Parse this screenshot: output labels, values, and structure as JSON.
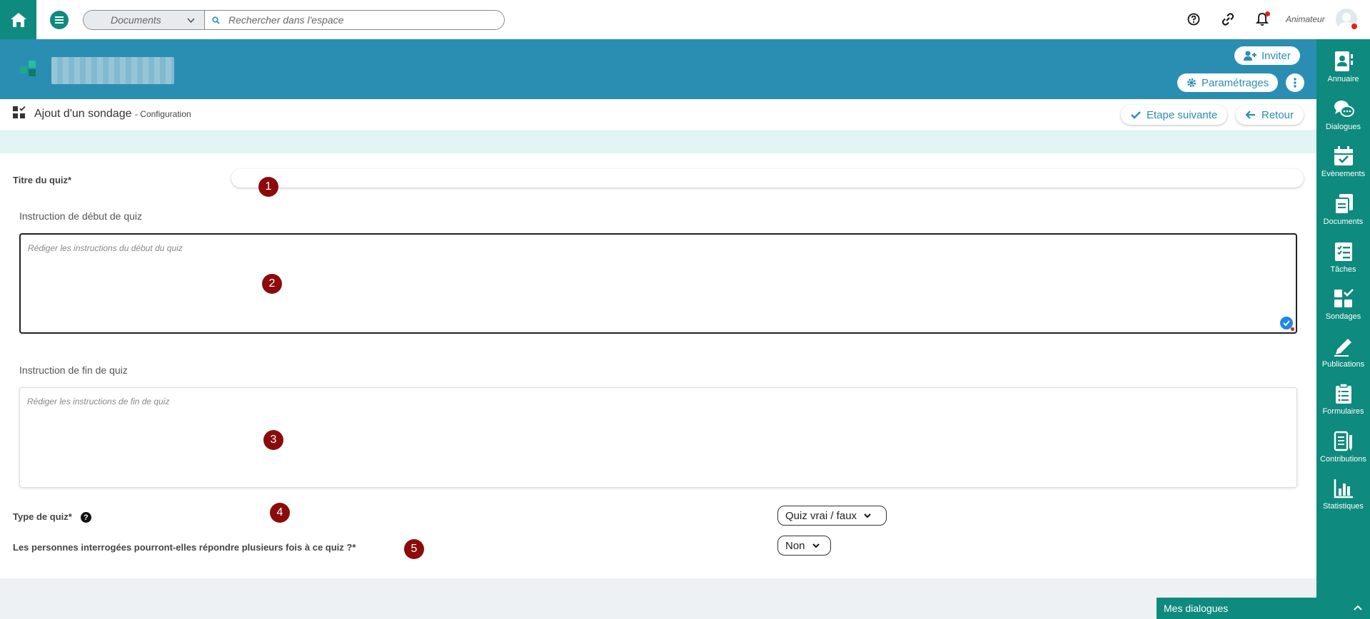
{
  "topbar": {
    "search_scope": "Documents",
    "search_placeholder": "Rechercher dans l'espace",
    "user_role": "Animateur",
    "icons": [
      "home-icon",
      "menu-icon",
      "help-icon",
      "link-icon",
      "bell-icon"
    ]
  },
  "banner": {
    "invite_label": "Inviter",
    "settings_label": "Paramétrages"
  },
  "page": {
    "title": "Ajout d'un sondage",
    "subtitle": "- Configuration",
    "next_label": "Etape suivante",
    "back_label": "Retour"
  },
  "form": {
    "quiz_title_label": "Titre du quiz*",
    "start_instruction_label": "Instruction de début de quiz",
    "start_instruction_placeholder": "Rédiger les instructions du début du quiz",
    "end_instruction_label": "Instruction de fin de quiz",
    "end_instruction_placeholder": "Rédiger les instructions de fin de quiz",
    "quiz_type_label": "Type de quiz*",
    "quiz_type_value": "Quiz vrai / faux",
    "multiple_answers_label": "Les personnes interrogées pourront-elles répondre plusieurs fois à ce quiz ?*",
    "multiple_answers_value": "Non",
    "help_glyph": "?"
  },
  "markers": [
    "1",
    "2",
    "3",
    "4",
    "5"
  ],
  "sidebar": {
    "items": [
      {
        "label": "Annuaire",
        "icon": "contacts-icon"
      },
      {
        "label": "Dialogues",
        "icon": "chat-icon"
      },
      {
        "label": "Evènements",
        "icon": "calendar-icon"
      },
      {
        "label": "Documents",
        "icon": "documents-icon"
      },
      {
        "label": "Tâches",
        "icon": "tasks-icon"
      },
      {
        "label": "Sondages",
        "icon": "polls-icon"
      },
      {
        "label": "Publications",
        "icon": "pencil-icon"
      },
      {
        "label": "Formulaires",
        "icon": "form-icon"
      },
      {
        "label": "Contributions",
        "icon": "contributions-icon"
      },
      {
        "label": "Statistiques",
        "icon": "stats-icon"
      }
    ]
  },
  "dialogues_bar": {
    "label": "Mes dialogues"
  },
  "colors": {
    "brand_green": "#0e8a7e",
    "banner_blue": "#2a8eb3",
    "marker_red": "#8b0b0b",
    "strip": "#e3f4f4"
  }
}
